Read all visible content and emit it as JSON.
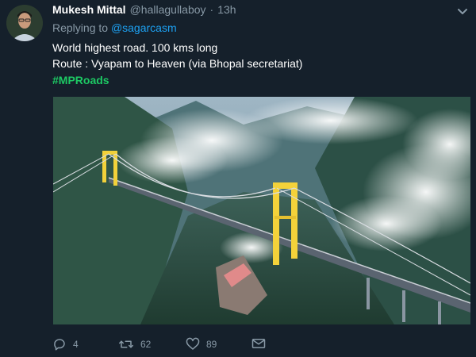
{
  "tweet": {
    "display_name": "Mukesh Mittal",
    "handle": "@hallagullaboy",
    "separator": "·",
    "time": "13h",
    "replying_prefix": "Replying to",
    "replying_handle": "@sagarcasm",
    "line1": "World highest road. 100 kms long",
    "line2": "Route : Vyapam to Heaven (via Bhopal secretariat)",
    "hashtag": "#MPRoads",
    "media_alt": "Aerial photo of a suspension bridge with yellow towers spanning a misty mountain valley"
  },
  "actions": {
    "reply_count": "4",
    "retweet_count": "62",
    "like_count": "89"
  },
  "colors": {
    "background": "#15202b",
    "link": "#1da1f2",
    "hashtag": "#1dc964",
    "muted": "#8899a6"
  },
  "icons": {
    "caret": "chevron-down-icon",
    "reply": "reply-icon",
    "retweet": "retweet-icon",
    "like": "heart-icon",
    "dm": "envelope-icon"
  }
}
